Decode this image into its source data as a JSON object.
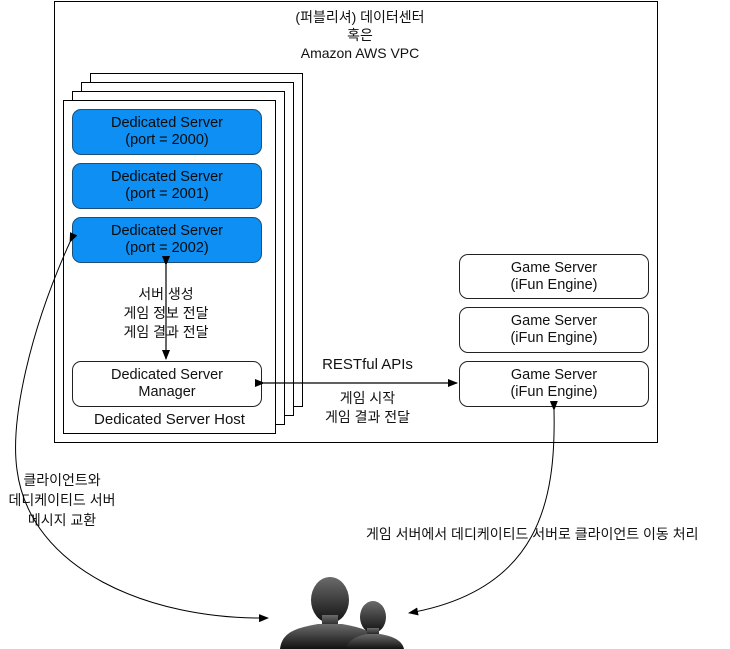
{
  "vpc": {
    "title_lines": [
      "(퍼블리셔) 데이터센터",
      "혹은",
      "Amazon AWS VPC"
    ]
  },
  "host": {
    "label": "Dedicated Server Host",
    "dedicated_servers": [
      {
        "name": "Dedicated Server",
        "port": "(port = 2000)"
      },
      {
        "name": "Dedicated Server",
        "port": "(port = 2001)"
      },
      {
        "name": "Dedicated Server",
        "port": "(port = 2002)"
      }
    ],
    "manager": {
      "line1": "Dedicated Server",
      "line2": "Manager"
    },
    "manager_link_label_lines": [
      "서버 생성",
      "게임 정보 전달",
      "게임 결과 전달"
    ]
  },
  "game_servers": [
    {
      "name": "Game Server",
      "engine": "(iFun Engine)"
    },
    {
      "name": "Game Server",
      "engine": "(iFun Engine)"
    },
    {
      "name": "Game Server",
      "engine": "(iFun Engine)"
    }
  ],
  "rest_link": {
    "title": "RESTful APIs",
    "lines": [
      "게임 시작",
      "게임 결과 전달"
    ]
  },
  "client_ds_link": {
    "lines": [
      "클라이언트와",
      "데디케이티드 서버",
      "메시지 교환"
    ]
  },
  "client_gs_link": {
    "label": "게임 서버에서 데디케이티드 서버로 클라이언트 이동 처리"
  },
  "users": {
    "icon": "users-silhouette-icon"
  },
  "colors": {
    "dedicated_server_fill": "#0d8ff3",
    "line": "#000000"
  }
}
